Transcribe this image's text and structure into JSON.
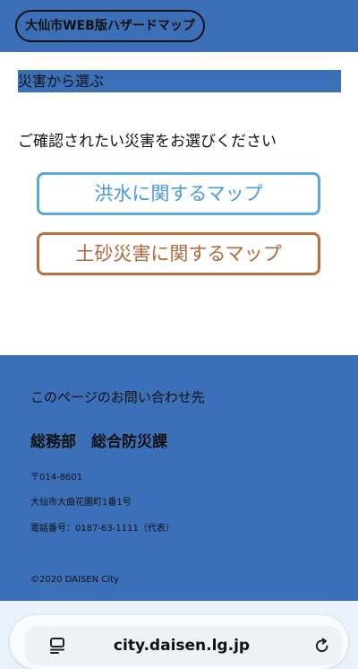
{
  "header": {
    "title": "大仙市WEB版ハザードマップ"
  },
  "main": {
    "section_title": "災害から選ぶ",
    "prompt": "ご確認されたい災害をお選びください",
    "buttons": {
      "flood": "洪水に関するマップ",
      "landslide": "土砂災害に関するマップ"
    }
  },
  "footer": {
    "contact_heading": "このページのお問い合わせ先",
    "department": "総務部　総合防災課",
    "postal": "〒014-8601",
    "address": "大仙市大曲花園町1番1号",
    "phone": "電話番号：0187-63-1111（代表）",
    "copyright": "©2020 DAISEN City"
  },
  "browser": {
    "url": "city.daisen.lg.jp",
    "tabs_icon": "tabs-icon",
    "reload_icon": "reload-icon"
  },
  "colors": {
    "brand_blue": "#3b6fb8",
    "flood_blue": "#5aa8e0",
    "landslide_brown": "#b8703e"
  }
}
